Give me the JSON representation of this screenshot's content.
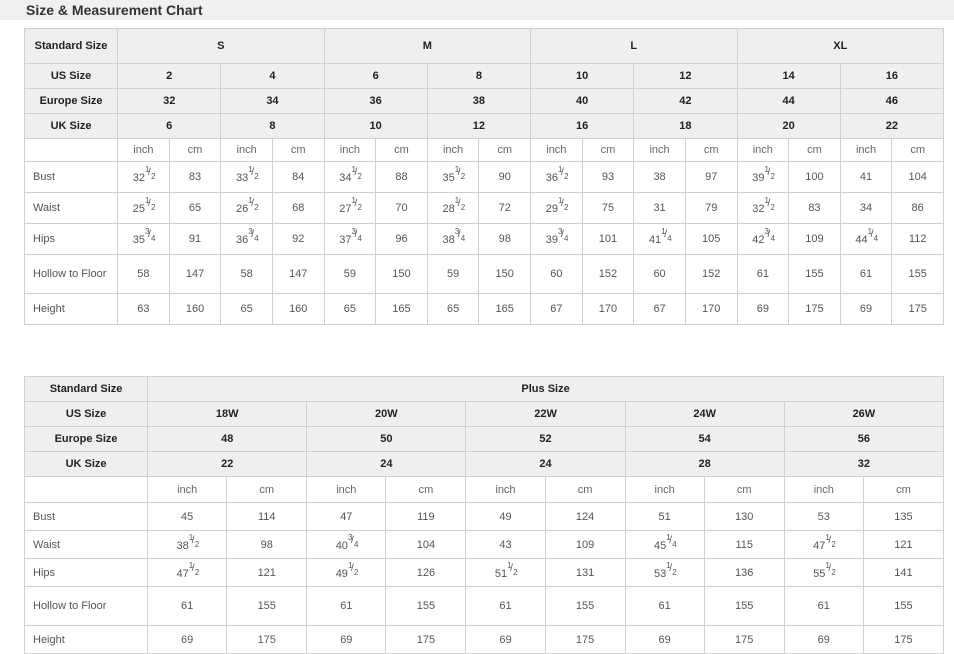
{
  "page": {
    "title": "Size & Measurement Chart"
  },
  "standard_table": {
    "corner_label": "Standard Size",
    "group_headers": [
      "S",
      "M",
      "L",
      "XL"
    ],
    "row_headers": [
      {
        "label": "US Size",
        "values": [
          "2",
          "4",
          "6",
          "8",
          "10",
          "12",
          "14",
          "16"
        ]
      },
      {
        "label": "Europe Size",
        "values": [
          "32",
          "34",
          "36",
          "38",
          "40",
          "42",
          "44",
          "46"
        ]
      },
      {
        "label": "UK Size",
        "values": [
          "6",
          "8",
          "10",
          "12",
          "16",
          "18",
          "20",
          "22"
        ]
      }
    ],
    "unit_row": {
      "label": "",
      "units": [
        "inch",
        "cm",
        "inch",
        "cm",
        "inch",
        "cm",
        "inch",
        "cm",
        "inch",
        "cm",
        "inch",
        "cm",
        "inch",
        "cm",
        "inch",
        "cm"
      ]
    },
    "measurements": [
      {
        "label": "Bust",
        "cells": [
          "32 1/2",
          "83",
          "33 1/2",
          "84",
          "34 1/2",
          "88",
          "35 1/2",
          "90",
          "36 1/2",
          "93",
          "38",
          "97",
          "39 1/2",
          "100",
          "41",
          "104"
        ]
      },
      {
        "label": "Waist",
        "cells": [
          "25 1/2",
          "65",
          "26 1/2",
          "68",
          "27 1/2",
          "70",
          "28 1/2",
          "72",
          "29 1/2",
          "75",
          "31",
          "79",
          "32 1/2",
          "83",
          "34",
          "86"
        ]
      },
      {
        "label": "Hips",
        "cells": [
          "35 3/4",
          "91",
          "36 3/4",
          "92",
          "37 3/4",
          "96",
          "38 3/4",
          "98",
          "39 3/4",
          "101",
          "41 1/4",
          "105",
          "42 3/4",
          "109",
          "44 1/4",
          "112"
        ]
      },
      {
        "label": "Hollow to Floor",
        "cells": [
          "58",
          "147",
          "58",
          "147",
          "59",
          "150",
          "59",
          "150",
          "60",
          "152",
          "60",
          "152",
          "61",
          "155",
          "61",
          "155"
        ]
      },
      {
        "label": "Height",
        "cells": [
          "63",
          "160",
          "65",
          "160",
          "65",
          "165",
          "65",
          "165",
          "67",
          "170",
          "67",
          "170",
          "69",
          "175",
          "69",
          "175"
        ]
      }
    ]
  },
  "plus_table": {
    "corner_label": "Standard Size",
    "group_header": "Plus Size",
    "row_headers": [
      {
        "label": "US Size",
        "values": [
          "18W",
          "20W",
          "22W",
          "24W",
          "26W"
        ]
      },
      {
        "label": "Europe Size",
        "values": [
          "48",
          "50",
          "52",
          "54",
          "56"
        ]
      },
      {
        "label": "UK Size",
        "values": [
          "22",
          "24",
          "24",
          "28",
          "32"
        ]
      }
    ],
    "unit_row": {
      "label": "",
      "units": [
        "inch",
        "cm",
        "inch",
        "cm",
        "inch",
        "cm",
        "inch",
        "cm",
        "inch",
        "cm"
      ]
    },
    "measurements": [
      {
        "label": "Bust",
        "cells": [
          "45",
          "114",
          "47",
          "119",
          "49",
          "124",
          "51",
          "130",
          "53",
          "135"
        ]
      },
      {
        "label": "Waist",
        "cells": [
          "38 1/2",
          "98",
          "40 3/4",
          "104",
          "43",
          "109",
          "45 1/4",
          "115",
          "47 1/2",
          "121"
        ]
      },
      {
        "label": "Hips",
        "cells": [
          "47 1/2",
          "121",
          "49 1/2",
          "126",
          "51 1/2",
          "131",
          "53 1/2",
          "136",
          "55 1/2",
          "141"
        ]
      },
      {
        "label": "Hollow to Floor",
        "cells": [
          "61",
          "155",
          "61",
          "155",
          "61",
          "155",
          "61",
          "155",
          "61",
          "155"
        ]
      },
      {
        "label": "Height",
        "cells": [
          "69",
          "175",
          "69",
          "175",
          "69",
          "175",
          "69",
          "175",
          "69",
          "175"
        ]
      }
    ]
  },
  "colors": {
    "title_bar": "#f0f0f0",
    "header_cell": "#efefef",
    "border": "#cfcfcf",
    "text": "#555555",
    "header_text": "#222222"
  }
}
